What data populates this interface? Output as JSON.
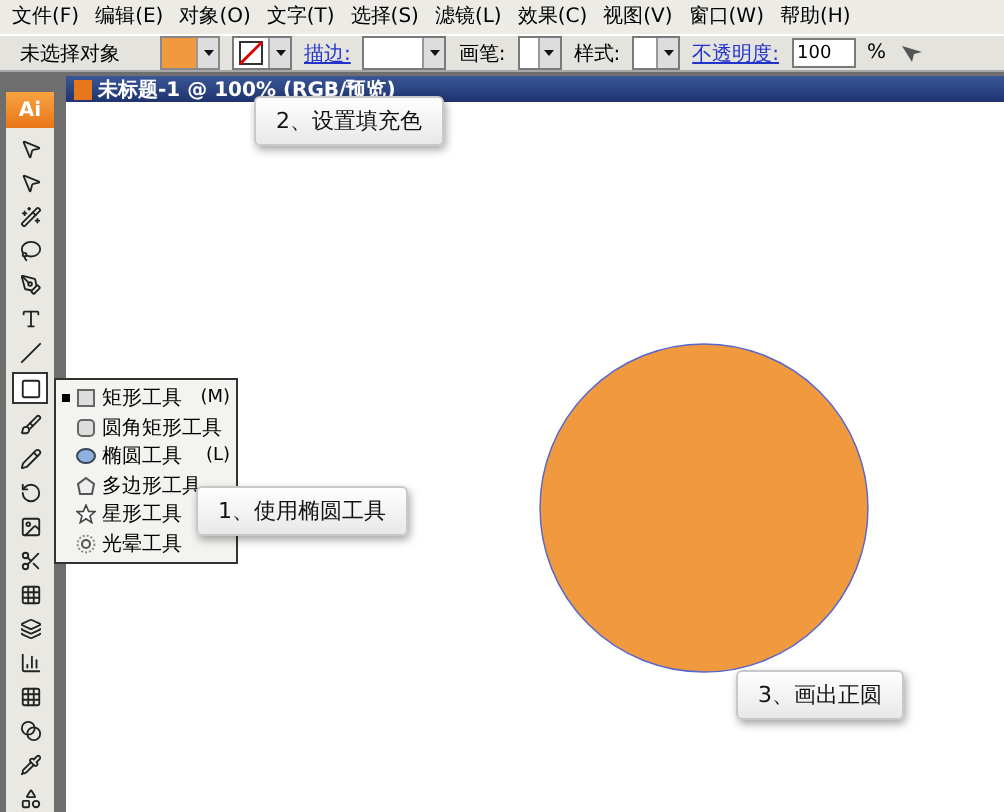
{
  "menu": [
    {
      "label": "文件(F)"
    },
    {
      "label": "编辑(E)"
    },
    {
      "label": "对象(O)"
    },
    {
      "label": "文字(T)"
    },
    {
      "label": "选择(S)"
    },
    {
      "label": "滤镜(L)"
    },
    {
      "label": "效果(C)"
    },
    {
      "label": "视图(V)"
    },
    {
      "label": "窗口(W)"
    },
    {
      "label": "帮助(H)"
    }
  ],
  "control_bar": {
    "selection_label": "未选择对象",
    "stroke_label": "描边:",
    "brush_label": "画笔:",
    "style_label": "样式:",
    "opacity_label": "不透明度:",
    "opacity_value": "100",
    "percent": "%"
  },
  "toolbox": {
    "logo": "Ai"
  },
  "document": {
    "title": "未标题-1 @ 100% (RGB/预览)",
    "shape": {
      "kind": "circle",
      "color": "#f0993f"
    }
  },
  "flyout": [
    {
      "label": "矩形工具",
      "shortcut": "(M)",
      "checked": true,
      "kind": "rect"
    },
    {
      "label": "圆角矩形工具",
      "checked": false,
      "kind": "rounded"
    },
    {
      "label": "椭圆工具",
      "shortcut": "(L)",
      "checked": false,
      "kind": "ellipse"
    },
    {
      "label": "多边形工具",
      "checked": false,
      "kind": "polygon"
    },
    {
      "label": "星形工具",
      "checked": false,
      "kind": "star"
    },
    {
      "label": "光晕工具",
      "checked": false,
      "kind": "flare"
    }
  ],
  "callouts": [
    {
      "text": "2、设置填充色"
    },
    {
      "text": "1、使用椭圆工具"
    },
    {
      "text": "3、画出正圆"
    }
  ]
}
